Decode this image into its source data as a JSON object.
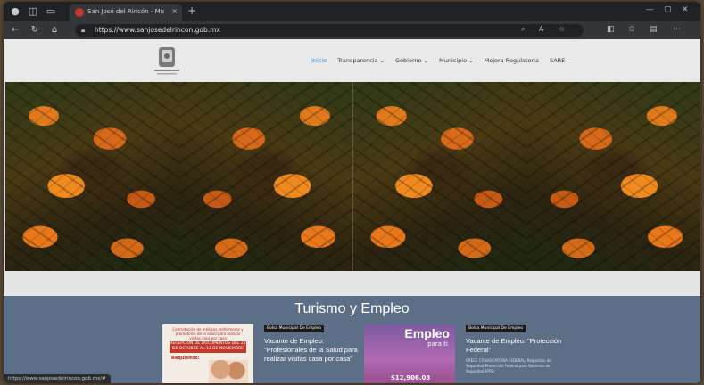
{
  "browser": {
    "tab_title": "San José del Rincón - Municipi...",
    "tab_close": "×",
    "new_tab": "+",
    "url": "https://www.sanjosedelrincon.gob.mx",
    "status_url": "https://www.sanjosedelrincon.gob.mx/#"
  },
  "site": {
    "menu": [
      "Inicio",
      "Transparencia ⌄",
      "Gobierno ⌄",
      "Municipio ⌄",
      "Mejora Regulatoria",
      "SARE"
    ],
    "section_title": "Turismo y Empleo",
    "cards": [
      {
        "tag": "Bolsa Municipal De Empleo",
        "title": "Vacante de Empleo: \"Profesionales de la Salud para realizar visitas casa por casa\""
      },
      {
        "tag": "Bolsa Municipal De Empleo",
        "title": "Vacante de Empleo: \"Protección Federal\"",
        "desc": "CRECE CONVOCATORIA FEDERAL/ Requisitos de Seguridad Protección Federal para Servicios de Seguridad (PFS)"
      }
    ],
    "doc_card": {
      "line1": "Contratación de médicos, enfermeras y promotores de la salud para realizar visitas casa por casa",
      "banner": "RECEPCIÓN DE DOCUMENTOS DEL 21 DE OCTUBRE AL 13 DE NOVIEMBRE",
      "requisitos": "Requisitos:"
    },
    "empleo_card": {
      "title": "Empleo",
      "subtitle": "para ti",
      "price": "$12,906.03"
    }
  }
}
